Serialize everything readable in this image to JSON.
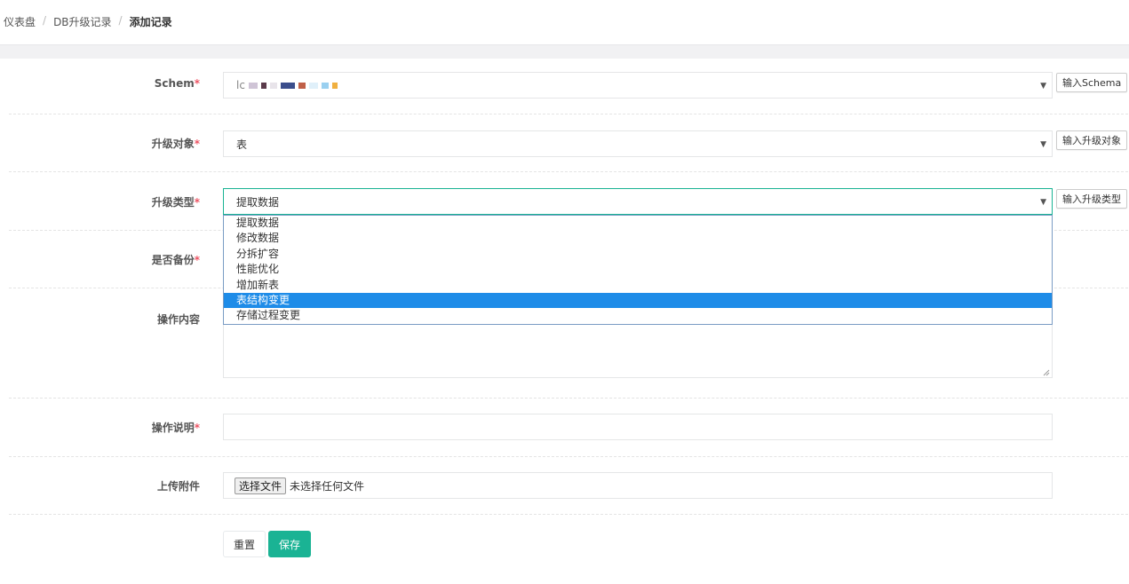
{
  "breadcrumb": {
    "items": [
      "仪表盘",
      "DB升级记录"
    ],
    "current": "添加记录",
    "separator": "/"
  },
  "form": {
    "schema": {
      "label": "Schem",
      "value": "lc",
      "button": "输入Schema"
    },
    "target": {
      "label": "升级对象",
      "value": "表",
      "button": "输入升级对象"
    },
    "upgrade_type": {
      "label": "升级类型",
      "value": "提取数据",
      "button": "输入升级类型",
      "options": [
        "提取数据",
        "修改数据",
        "分拆扩容",
        "性能优化",
        "增加新表",
        "表结构变更",
        "存储过程变更"
      ],
      "highlighted": "表结构变更"
    },
    "backup": {
      "label": "是否备份"
    },
    "content": {
      "label": "操作内容"
    },
    "description": {
      "label": "操作说明"
    },
    "attachment": {
      "label": "上传附件",
      "button": "选择文件",
      "status": "未选择任何文件"
    },
    "required_mark": "*"
  },
  "actions": {
    "reset": "重置",
    "save": "保存"
  },
  "colors": {
    "accent": "#1ab394",
    "required": "#ed5565",
    "highlight": "#1e8ce8"
  }
}
